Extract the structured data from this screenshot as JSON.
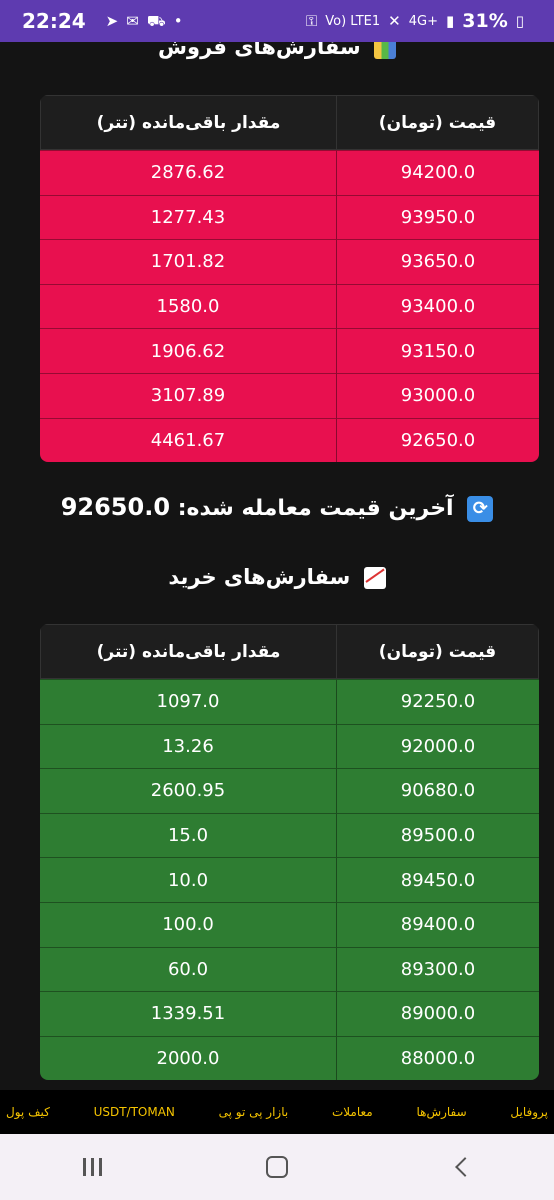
{
  "status_bar": {
    "time": "22:24",
    "network": "Vo) LTE1",
    "signal": "4G+",
    "battery": "31%"
  },
  "sell_section": {
    "title": "سفارش‌های فروش",
    "headers": {
      "price": "قیمت (تومان)",
      "amount": "مقدار باقی‌مانده (تتر)"
    },
    "rows": [
      {
        "price": "94200.0",
        "amount": "2876.62"
      },
      {
        "price": "93950.0",
        "amount": "1277.43"
      },
      {
        "price": "93650.0",
        "amount": "1701.82"
      },
      {
        "price": "93400.0",
        "amount": "1580.0"
      },
      {
        "price": "93150.0",
        "amount": "1906.62"
      },
      {
        "price": "93000.0",
        "amount": "3107.89"
      },
      {
        "price": "92650.0",
        "amount": "4461.67"
      }
    ]
  },
  "last_trade": {
    "label": "آخرین قیمت معامله شده:",
    "value": "92650.0"
  },
  "buy_section": {
    "title": "سفارش‌های خرید",
    "headers": {
      "price": "قیمت (تومان)",
      "amount": "مقدار باقی‌مانده (تتر)"
    },
    "rows": [
      {
        "price": "92250.0",
        "amount": "1097.0"
      },
      {
        "price": "92000.0",
        "amount": "13.26"
      },
      {
        "price": "90680.0",
        "amount": "2600.95"
      },
      {
        "price": "89500.0",
        "amount": "15.0"
      },
      {
        "price": "89450.0",
        "amount": "10.0"
      },
      {
        "price": "89400.0",
        "amount": "100.0"
      },
      {
        "price": "89300.0",
        "amount": "60.0"
      },
      {
        "price": "89000.0",
        "amount": "1339.51"
      },
      {
        "price": "88000.0",
        "amount": "2000.0"
      }
    ]
  },
  "bottom_nav": {
    "items": [
      "پروفایل",
      "سفارش‌ها",
      "معاملات",
      "بازار پی تو پی",
      "USDT/TOMAN",
      "کیف پول"
    ]
  },
  "colors": {
    "sell_row": "#e8104f",
    "buy_row": "#2e7d32",
    "nav_text": "#f5c400",
    "status_bar": "#5e3bb0"
  }
}
